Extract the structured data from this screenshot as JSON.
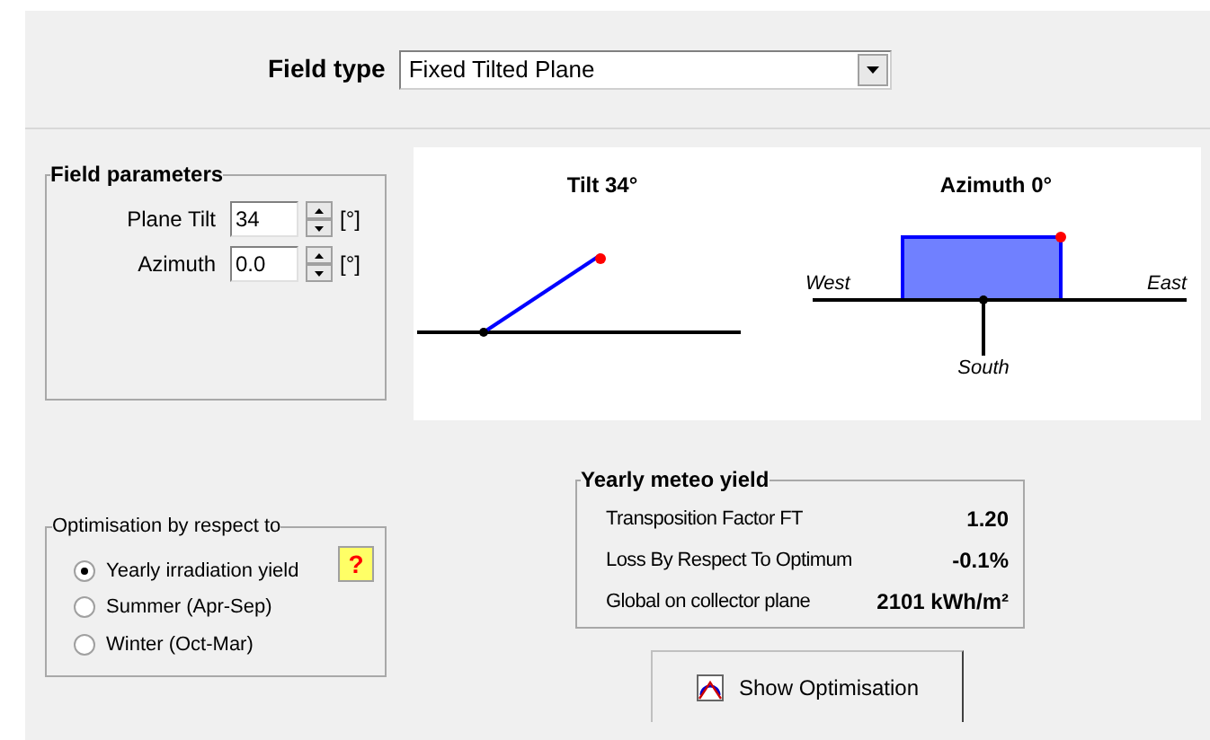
{
  "field_type": {
    "label": "Field type",
    "value": "Fixed Tilted Plane"
  },
  "field_parameters": {
    "title": "Field parameters",
    "params": [
      {
        "label": "Plane Tilt",
        "value": "34",
        "unit": "[°]"
      },
      {
        "label": "Azimuth",
        "value": "0.0",
        "unit": "[°]"
      }
    ]
  },
  "diagrams": {
    "tilt_title": "Tilt 34°",
    "azimuth_title": "Azimuth 0°",
    "west": "West",
    "east": "East",
    "south": "South"
  },
  "optimisation": {
    "title": "Optimisation by respect to",
    "help": "?",
    "options": [
      {
        "label": "Yearly irradiation yield",
        "selected": true
      },
      {
        "label": "Summer (Apr-Sep)",
        "selected": false
      },
      {
        "label": "Winter (Oct-Mar)",
        "selected": false
      }
    ]
  },
  "yearly_meteo_yield": {
    "title": "Yearly meteo yield",
    "rows": [
      {
        "label": "Transposition Factor FT",
        "value": "1.20"
      },
      {
        "label": "Loss By Respect To Optimum",
        "value": "-0.1%"
      },
      {
        "label": "Global on collector plane",
        "value": "2101 kWh/m²"
      }
    ]
  },
  "show_optimisation_button": "Show Optimisation"
}
